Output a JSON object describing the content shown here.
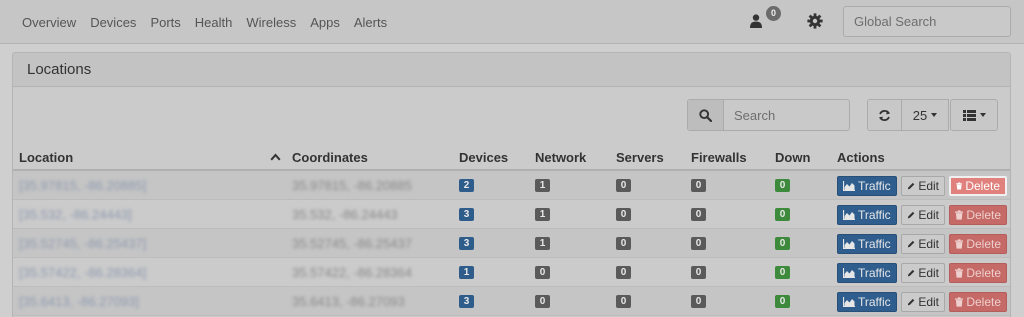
{
  "nav": {
    "links": [
      "Overview",
      "Devices",
      "Ports",
      "Health",
      "Wireless",
      "Apps",
      "Alerts"
    ],
    "notification_count": "0",
    "global_search_placeholder": "Global Search"
  },
  "panel": {
    "title": "Locations",
    "search_placeholder": "Search",
    "page_size": "25"
  },
  "table": {
    "headers": {
      "location": "Location",
      "coordinates": "Coordinates",
      "devices": "Devices",
      "network": "Network",
      "servers": "Servers",
      "firewalls": "Firewalls",
      "down": "Down",
      "actions": "Actions"
    },
    "rows": [
      {
        "location": "[35.97815, -86.20885]",
        "coordinates": "35.97815, -86.20885",
        "devices": "2",
        "network": "1",
        "servers": "0",
        "firewalls": "0",
        "down": "0"
      },
      {
        "location": "[35.532, -86.24443]",
        "coordinates": "35.532, -86.24443",
        "devices": "3",
        "network": "1",
        "servers": "0",
        "firewalls": "0",
        "down": "0"
      },
      {
        "location": "[35.52745, -86.25437]",
        "coordinates": "35.52745, -86.25437",
        "devices": "3",
        "network": "1",
        "servers": "0",
        "firewalls": "0",
        "down": "0"
      },
      {
        "location": "[35.57422, -86.28364]",
        "coordinates": "35.57422, -86.28364",
        "devices": "1",
        "network": "0",
        "servers": "0",
        "firewalls": "0",
        "down": "0"
      },
      {
        "location": "[35.6413, -86.27093]",
        "coordinates": "35.6413, -86.27093",
        "devices": "3",
        "network": "0",
        "servers": "0",
        "firewalls": "0",
        "down": "0"
      }
    ],
    "actions": {
      "traffic": "Traffic",
      "edit": "Edit",
      "delete": "Delete"
    }
  },
  "colors": {
    "label_blue": "#2e5d8c",
    "label_gray": "#5a5a5a",
    "label_green": "#3d8a3d",
    "delete_red": "#e0817d"
  },
  "icons": [
    "user-icon",
    "gear-icon",
    "search-icon",
    "refresh-icon",
    "list-icon",
    "sort-asc-icon",
    "area-chart-icon",
    "pencil-icon",
    "trash-icon"
  ]
}
